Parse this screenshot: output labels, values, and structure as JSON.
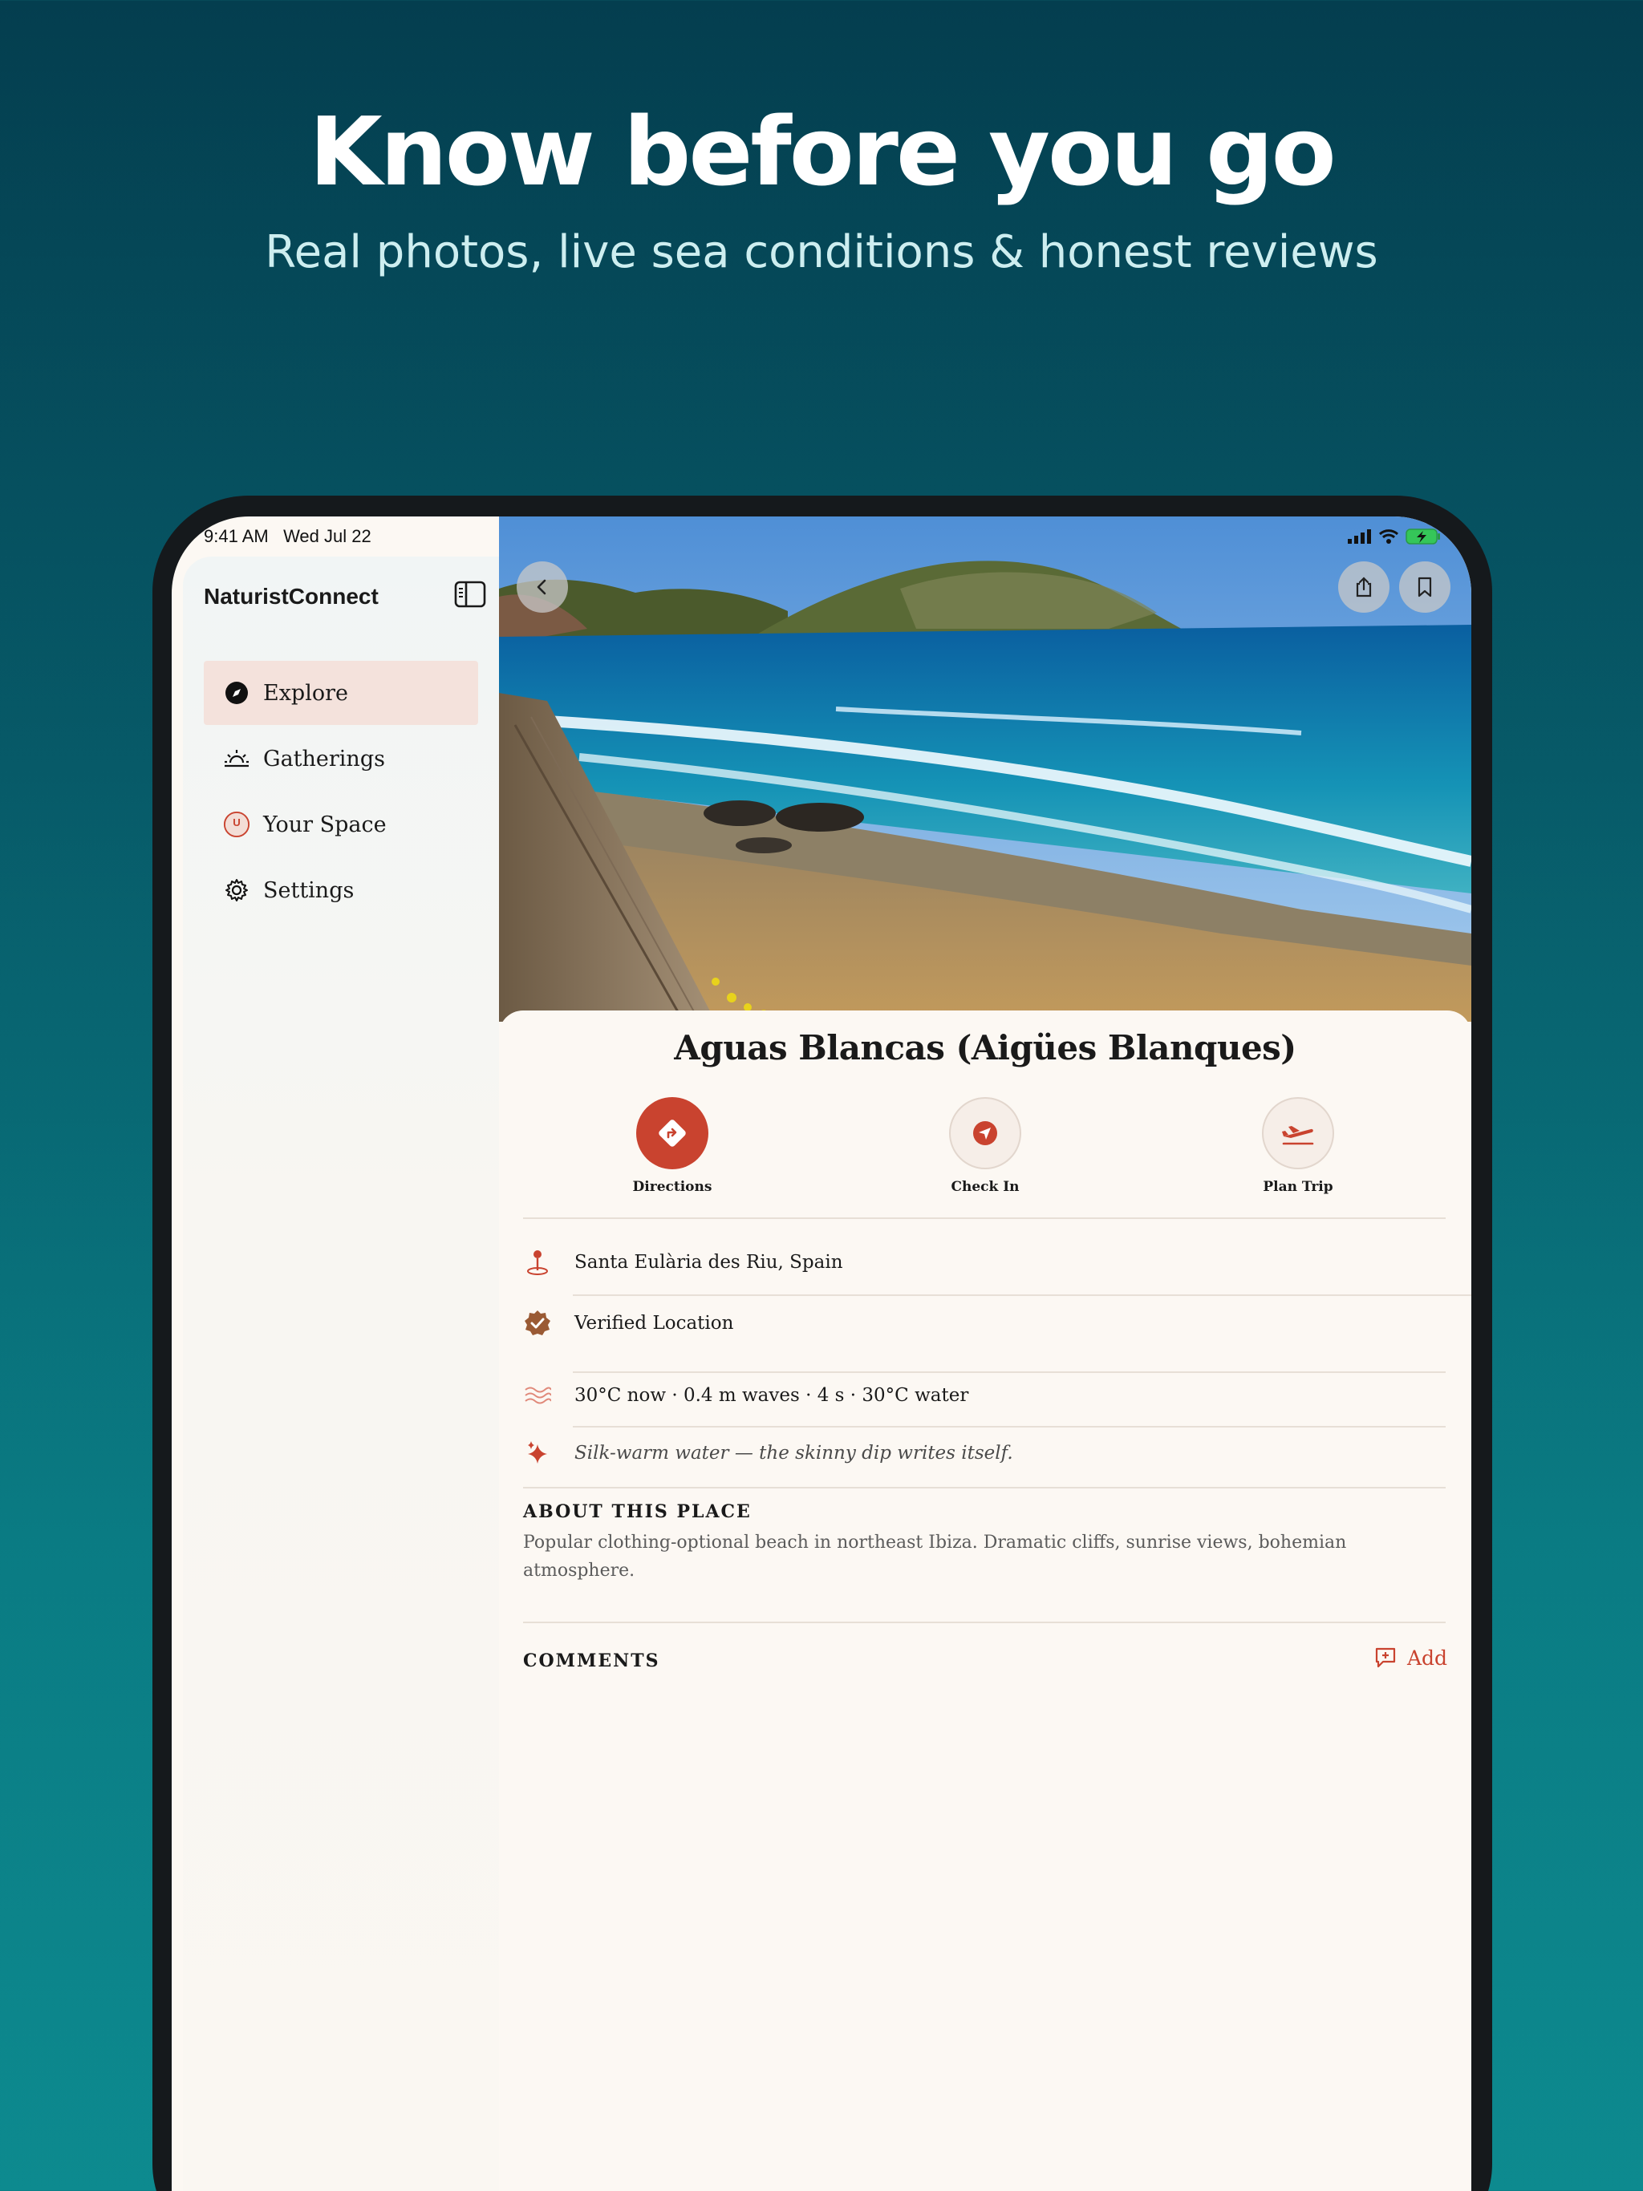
{
  "marketing": {
    "headline": "Know before you go",
    "subheadline": "Real photos, live sea conditions & honest reviews"
  },
  "status_bar": {
    "time": "9:41 AM",
    "date": "Wed Jul 22",
    "icons": [
      "cellular-signal-icon",
      "wifi-icon",
      "battery-charging-icon"
    ]
  },
  "sidebar": {
    "app_name": "NaturistConnect",
    "toggle_icon": "sidebar-toggle-icon",
    "items": [
      {
        "label": "Explore",
        "icon": "compass-icon",
        "active": true
      },
      {
        "label": "Gatherings",
        "icon": "sunrise-icon",
        "active": false
      },
      {
        "label": "Your Space",
        "icon": "user-avatar-icon",
        "active": false
      },
      {
        "label": "Settings",
        "icon": "gear-icon",
        "active": false
      }
    ]
  },
  "hero": {
    "back_icon": "chevron-left-icon",
    "share_icon": "share-icon",
    "bookmark_icon": "bookmark-icon"
  },
  "place": {
    "title": "Aguas Blancas (Aigües Blanques)",
    "actions": [
      {
        "label": "Directions",
        "icon": "directions-icon"
      },
      {
        "label": "Check In",
        "icon": "location-arrow-icon"
      },
      {
        "label": "Plan Trip",
        "icon": "airplane-icon"
      }
    ],
    "location": "Santa Eulària des Riu, Spain",
    "verified": "Verified Location",
    "conditions": "30°C now · 0.4 m waves · 4 s · 30°C water",
    "tip": "Silk-warm water — the skinny dip writes itself.",
    "about_heading": "ABOUT THIS PLACE",
    "about_text": "Popular clothing-optional beach in northeast Ibiza. Dramatic cliffs, sunrise views, bohemian atmosphere.",
    "comments_heading": "COMMENTS",
    "add_label": "Add"
  },
  "colors": {
    "accent": "#c9432f",
    "background_top": "#043e4f",
    "background_bottom": "#0d8a8f",
    "card": "#fcf8f3",
    "verified": "#9a5a34"
  }
}
